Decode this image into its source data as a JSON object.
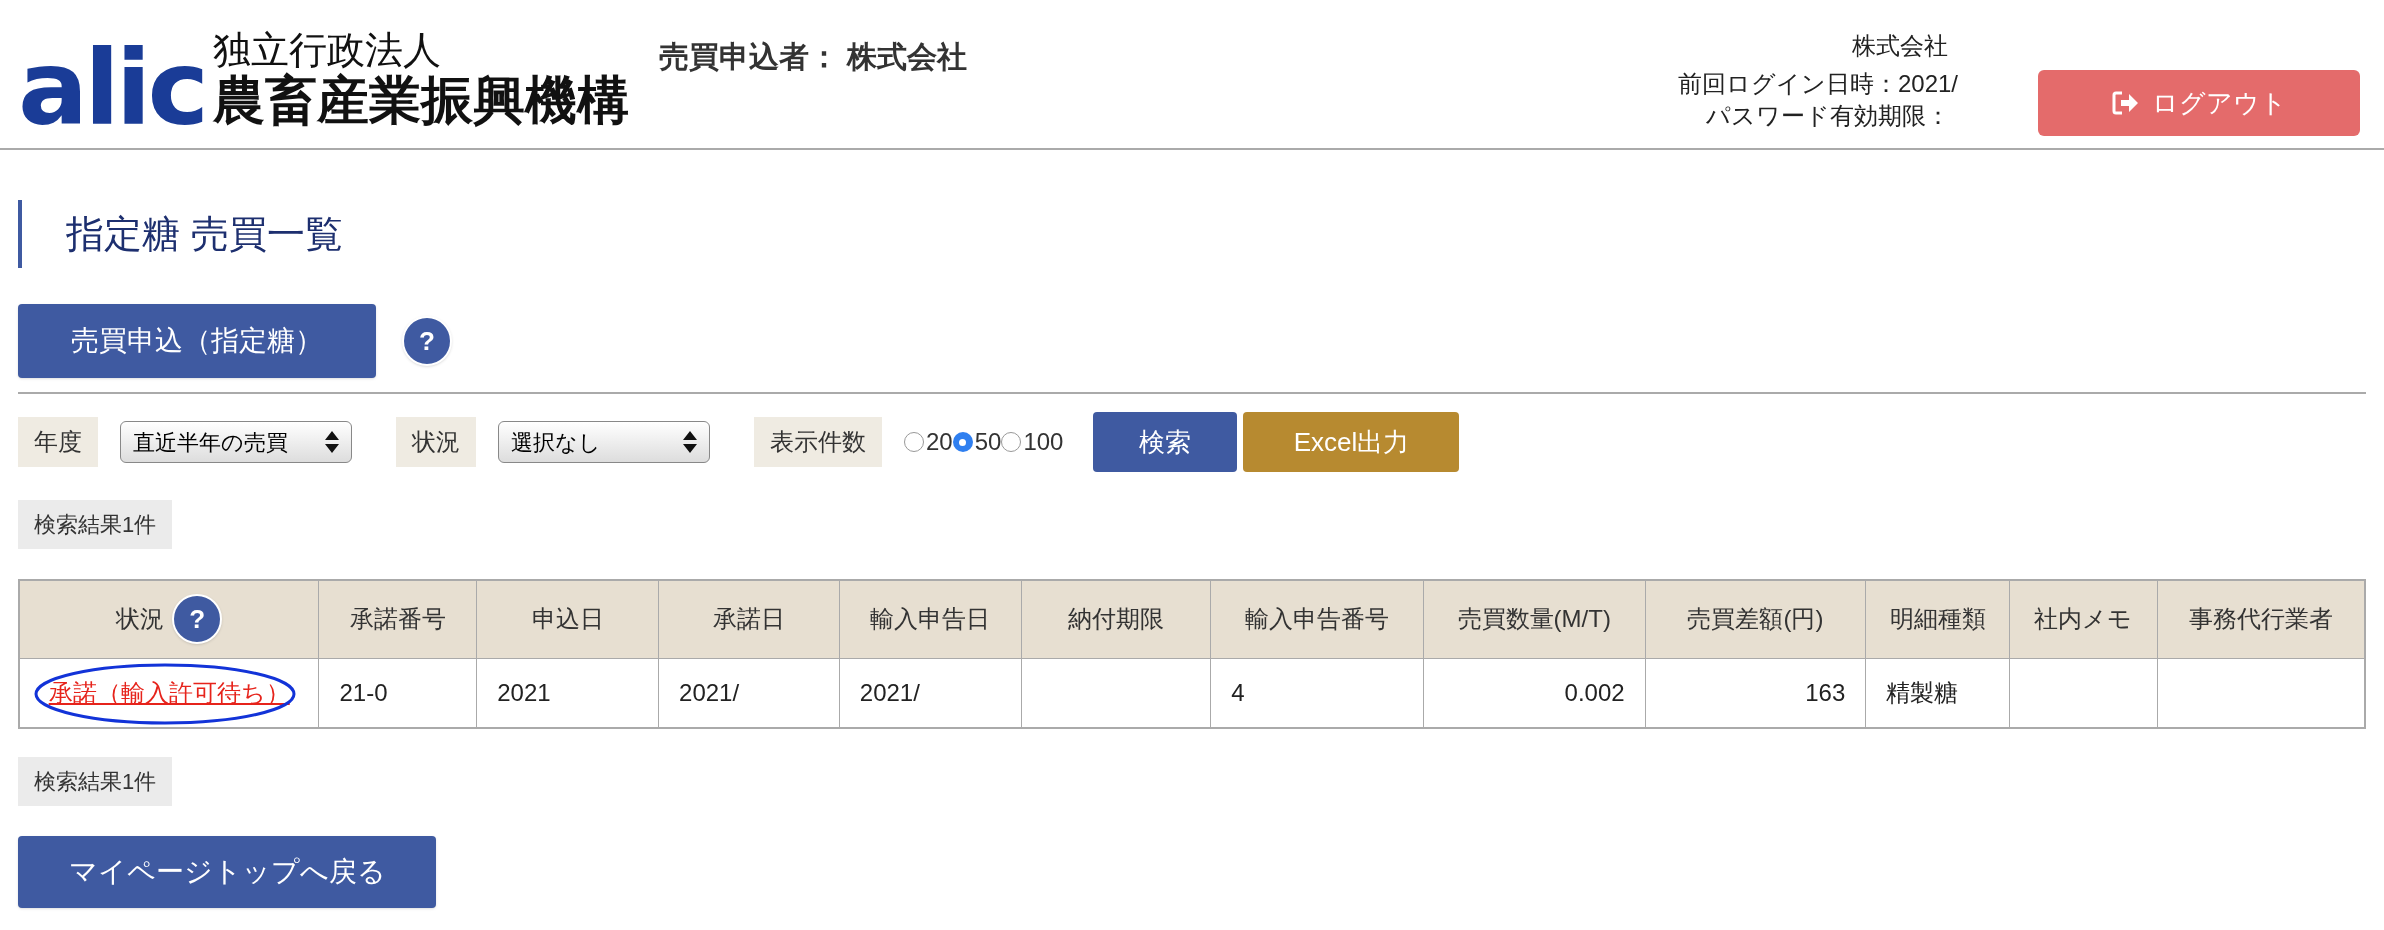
{
  "header": {
    "logo": {
      "mark": "alic",
      "line1": "独立行政法人",
      "line2": "農畜産業振興機構"
    },
    "applicant": "売買申込者： 株式会社",
    "company": "株式会社",
    "last_login": "前回ログイン日時：2021/",
    "password_expiry": "パスワード有効期限：",
    "logout": "ログアウト"
  },
  "page_title": "指定糖 売買一覧",
  "apply_button": "売買申込（指定糖）",
  "help_mark": "?",
  "filters": [
    {
      "kind": "select",
      "label": "年度",
      "value": "直近半年の売買"
    },
    {
      "kind": "select",
      "label": "状況",
      "value": "選択なし"
    },
    {
      "kind": "radio",
      "label": "表示件数",
      "options": [
        {
          "label": "20",
          "selected": false
        },
        {
          "label": "50",
          "selected": true
        },
        {
          "label": "100",
          "selected": false
        }
      ]
    }
  ],
  "search_button": "検索",
  "excel_button": "Excel出力",
  "result_count_top": "検索結果1件",
  "table": {
    "columns": [
      {
        "label": "状況",
        "help": "?"
      },
      {
        "label": "承諾番号"
      },
      {
        "label": "申込日"
      },
      {
        "label": "承諾日"
      },
      {
        "label": "輸入申告日"
      },
      {
        "label": "納付期限"
      },
      {
        "label": "輸入申告番号"
      },
      {
        "label": "売買数量(M/T)"
      },
      {
        "label": "売買差額(円)"
      },
      {
        "label": "明細種類"
      },
      {
        "label": "社内メモ"
      },
      {
        "label": "事務代行業者"
      }
    ],
    "rows": [
      {
        "circled": true,
        "cells": [
          {
            "kind": "link",
            "text": "承諾（輸入許可待ち）"
          },
          {
            "kind": "text",
            "text": "21-0"
          },
          {
            "kind": "text",
            "text": "2021"
          },
          {
            "kind": "text",
            "text": "2021/"
          },
          {
            "kind": "text",
            "text": "2021/"
          },
          {
            "kind": "text",
            "text": ""
          },
          {
            "kind": "text",
            "text": "4"
          },
          {
            "kind": "number",
            "text": "0.002"
          },
          {
            "kind": "number",
            "text": "163"
          },
          {
            "kind": "text",
            "text": "精製糖"
          },
          {
            "kind": "text",
            "text": ""
          },
          {
            "kind": "text",
            "text": ""
          }
        ]
      }
    ]
  },
  "result_count_bottom": "検索結果1件",
  "back_button": "マイページトップへ戻る"
}
